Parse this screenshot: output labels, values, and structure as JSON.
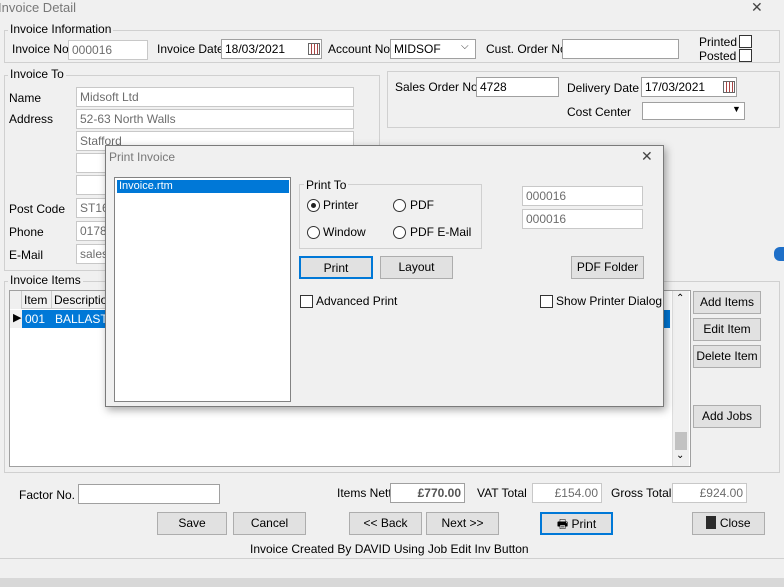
{
  "window": {
    "title": "Invoice Detail",
    "close_glyph": "✕"
  },
  "invoice_info": {
    "group_title": "Invoice Information",
    "invoice_no_label": "Invoice No",
    "invoice_no": "000016",
    "invoice_date_label": "Invoice Date",
    "invoice_date": "18/03/2021",
    "account_no_label": "Account No.",
    "account_no": "MIDSOF",
    "cust_order_label": "Cust. Order No.",
    "cust_order_no": "",
    "printed_label": "Printed",
    "posted_label": "Posted"
  },
  "invoice_to": {
    "group_title": "Invoice To",
    "name_label": "Name",
    "name": "Midsoft Ltd",
    "address_label": "Address",
    "address_line1": "52-63 North Walls",
    "address_line2": "Stafford",
    "address_line3": "",
    "address_line4": "",
    "postcode_label": "Post Code",
    "postcode": "ST16",
    "phone_label": "Phone",
    "phone": "01785",
    "email_label": "E-Mail",
    "email": "sales("
  },
  "order": {
    "sales_order_label": "Sales Order No.",
    "sales_order_no": "4728",
    "delivery_date_label": "Delivery Date",
    "delivery_date": "17/03/2021",
    "cost_center_label": "Cost Center",
    "cost_center": ""
  },
  "items": {
    "group_title": "Invoice Items",
    "columns": [
      "Item",
      "Description"
    ],
    "rows": [
      {
        "item": "001",
        "description": "BALLAST"
      }
    ],
    "add_items_label": "Add Items",
    "edit_item_label": "Edit Item",
    "delete_item_label": "Delete Item",
    "add_jobs_label": "Add Jobs"
  },
  "totals": {
    "factor_label": "Factor No.",
    "factor_no": "",
    "items_nett_label": "Items Nett",
    "items_nett": "£770.00",
    "vat_total_label": "VAT Total",
    "vat_total": "£154.00",
    "gross_total_label": "Gross Total",
    "gross_total": "£924.00"
  },
  "footer": {
    "save_label": "Save",
    "cancel_label": "Cancel",
    "back_label": "<< Back",
    "next_label": "Next >>",
    "print_label": "Print",
    "close_label": "Close",
    "status_text": "Invoice Created By DAVID Using Job Edit Inv Button"
  },
  "print_dialog": {
    "title": "Print Invoice",
    "templates": [
      "Invoice.rtm"
    ],
    "print_to_title": "Print To",
    "printer_label": "Printer",
    "pdf_label": "PDF",
    "window_label": "Window",
    "pdf_email_label": "PDF  E-Mail",
    "from_no": "000016",
    "to_no": "000016",
    "print_button_label": "Print",
    "layout_button_label": "Layout",
    "pdf_folder_label": "PDF Folder",
    "advanced_print_label": "Advanced Print",
    "show_printer_dialog_label": "Show Printer Dialog",
    "selected_destination": "Printer"
  },
  "colors": {
    "selection": "#0078d7",
    "window_bg": "#f0f0f0"
  }
}
